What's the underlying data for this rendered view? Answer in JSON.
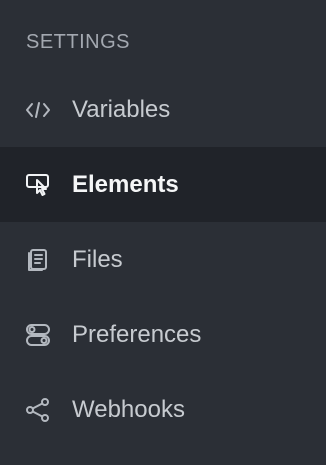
{
  "sidebar": {
    "section_title": "SETTINGS",
    "active_item": "Elements",
    "items": [
      {
        "label": "Variables",
        "icon": "code-icon"
      },
      {
        "label": "Elements",
        "icon": "cursor-click-icon"
      },
      {
        "label": "Files",
        "icon": "file-document-icon"
      },
      {
        "label": "Preferences",
        "icon": "toggle-settings-icon"
      },
      {
        "label": "Webhooks",
        "icon": "share-icon"
      }
    ]
  },
  "theme": {
    "background": "#2b2f36",
    "active_background": "#202329",
    "text_color": "#c7cbd0",
    "active_text_color": "#f5f6f7",
    "muted_text_color": "#a3a8b0"
  }
}
